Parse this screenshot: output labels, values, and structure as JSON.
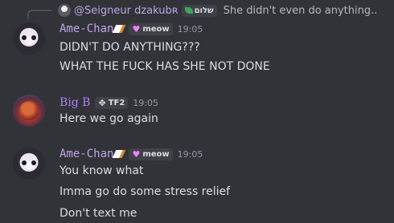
{
  "reply": {
    "username": "@Seigneur dzakubʀ",
    "tag": "שלום",
    "text": "She didn't even do anything.."
  },
  "messages": [
    {
      "author": "Ame-Chan",
      "badge": "meow",
      "time": "19:05",
      "lines": [
        "DIDN'T DO ANYTHING???",
        "WHAT THE FUCK HAS SHE NOT DONE"
      ]
    },
    {
      "author": "Big B",
      "badge": "TF2",
      "time": "19:05",
      "lines": [
        "Here we go again"
      ]
    },
    {
      "author": "Ame-Chan",
      "badge": "meow",
      "time": "19:05",
      "lines": [
        "You know what",
        "Imma go do some stress relief",
        "Don't text me"
      ]
    }
  ],
  "colors": {
    "background": "#313338",
    "text": "#dbdee1",
    "ame_name": "#c0a5e8",
    "big_name": "#b080f0",
    "timestamp": "#949ba4"
  }
}
